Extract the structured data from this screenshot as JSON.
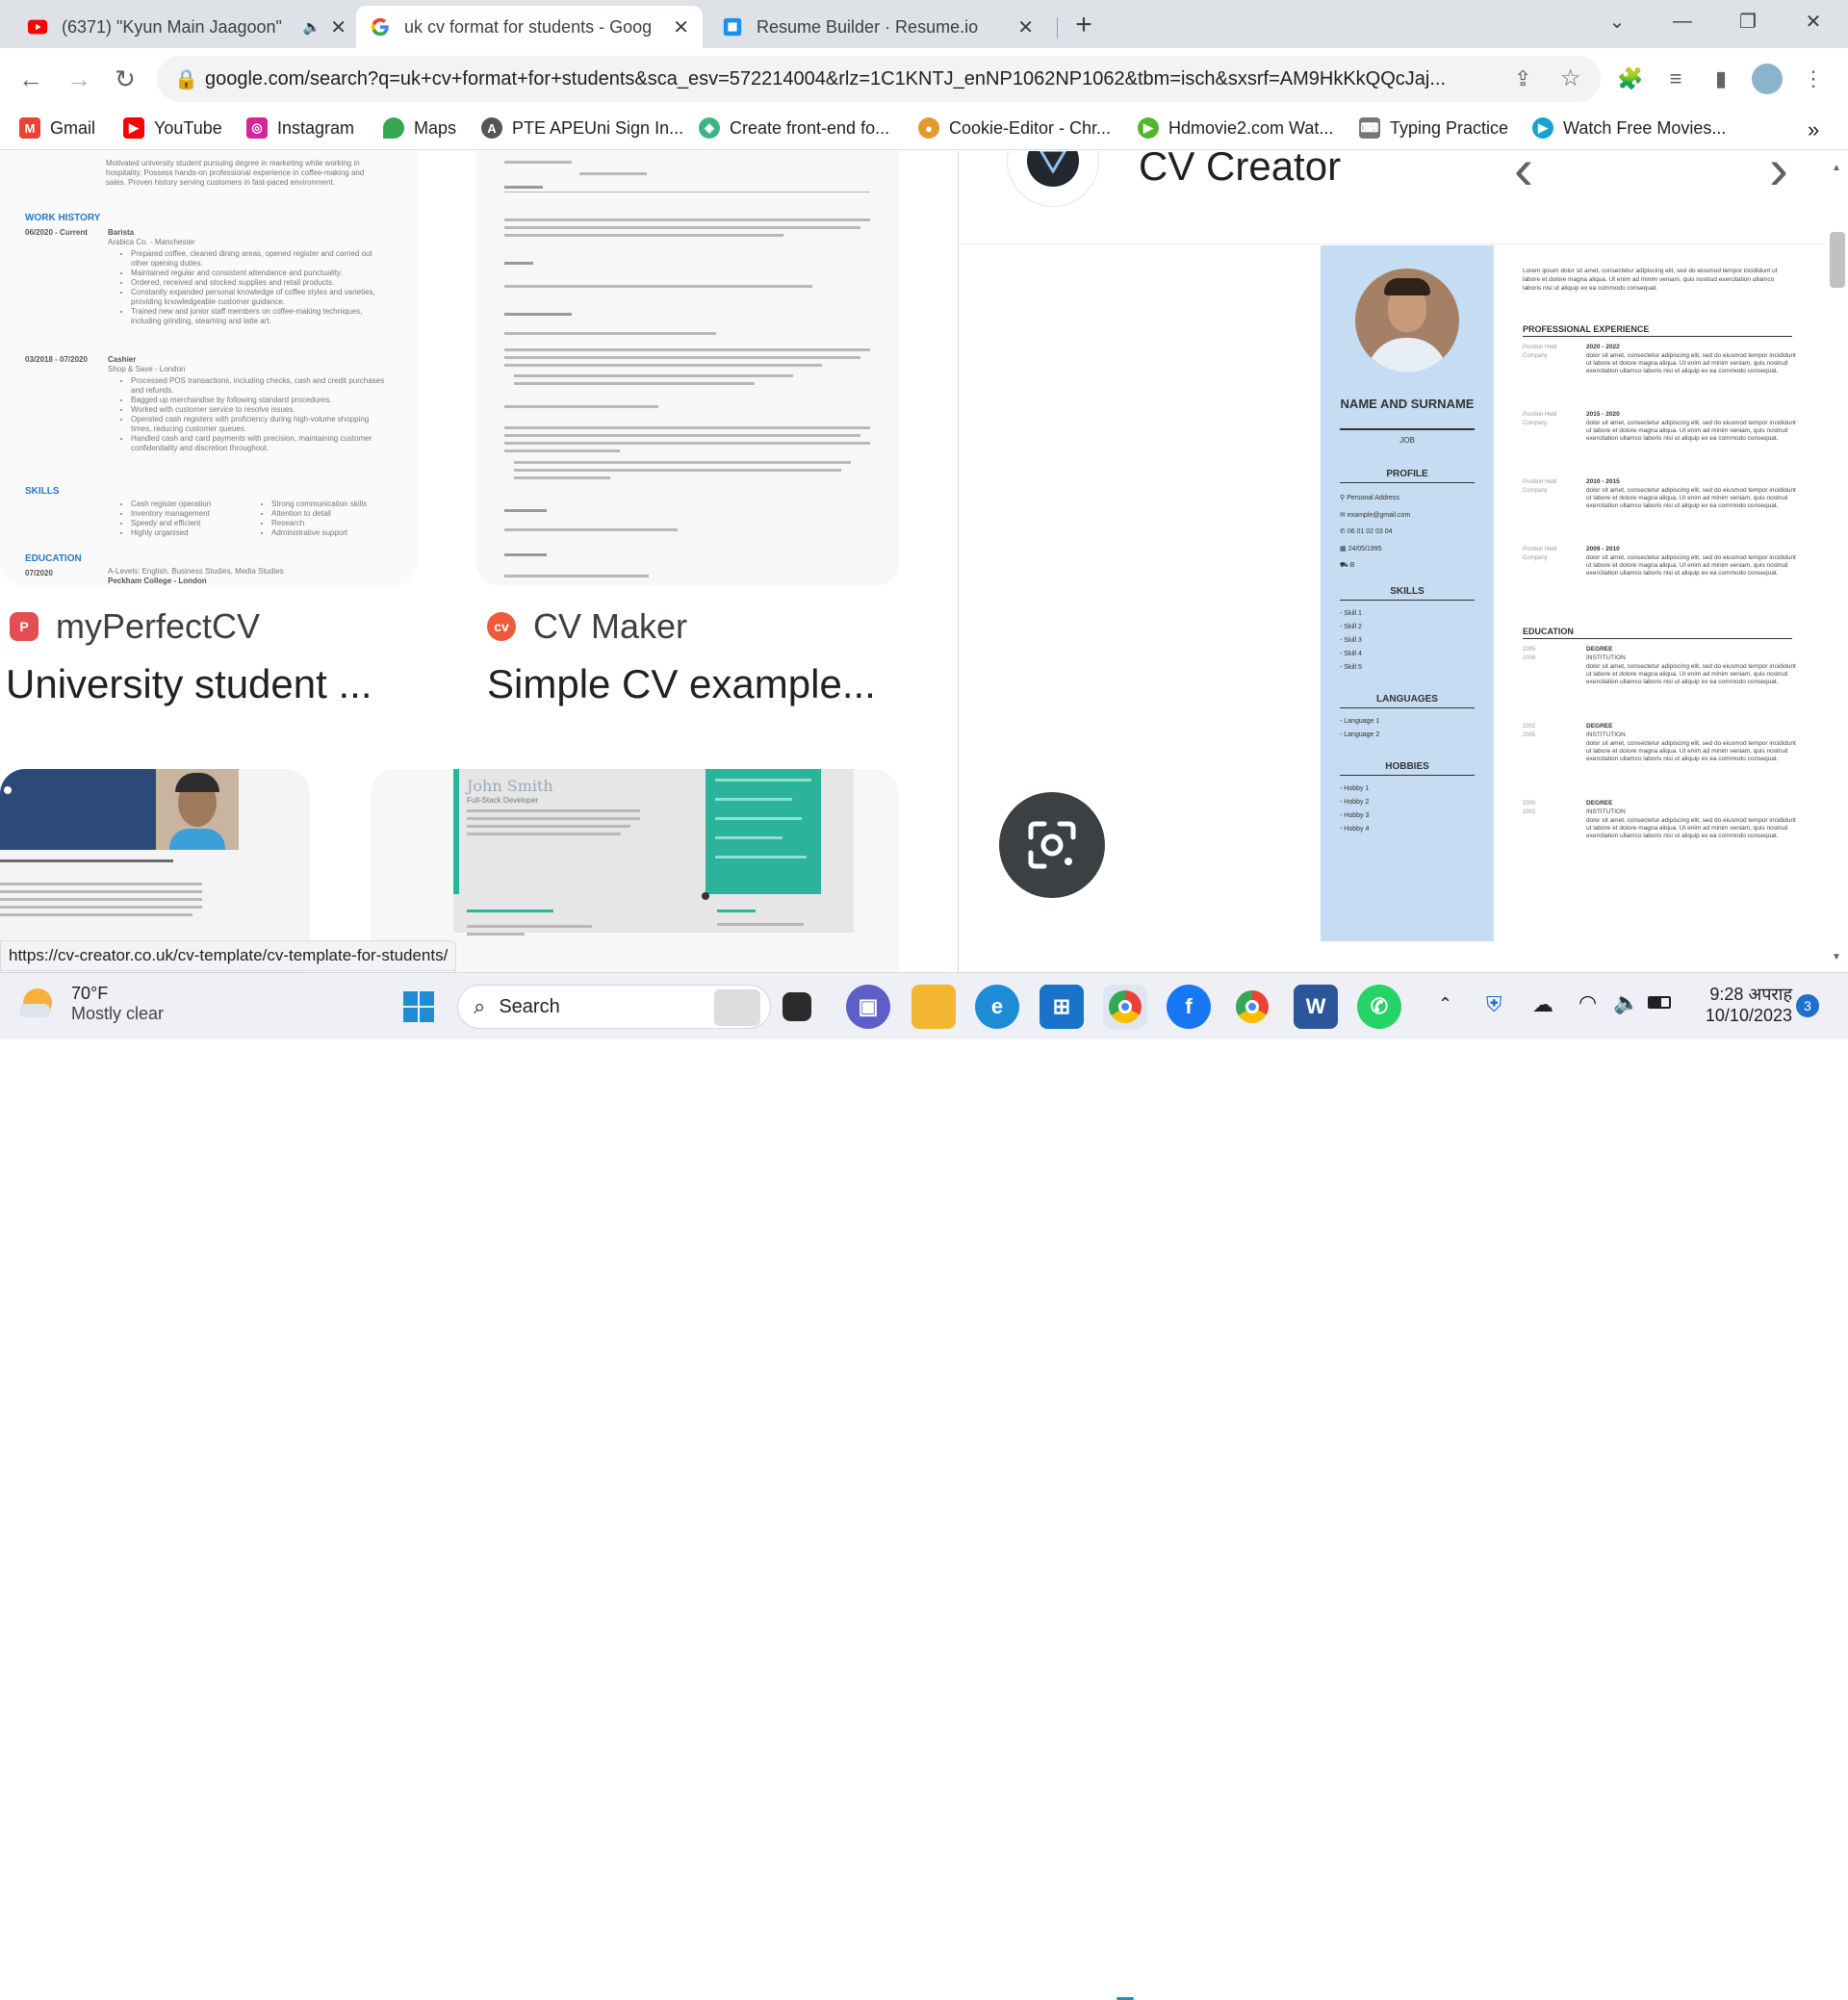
{
  "browser": {
    "tabs": [
      {
        "title": "(6371) \"Kyun Main Jaagoon\"",
        "favicon": "youtube-icon",
        "active": false
      },
      {
        "title": "uk cv format for students - Goog",
        "favicon": "google-icon",
        "active": true
      },
      {
        "title": "Resume Builder · Resume.io",
        "favicon": "resume-io-icon",
        "active": false
      }
    ],
    "new_tab": "+",
    "url": "google.com/search?q=uk+cv+format+for+students&sca_esv=572214004&rlz=1C1KNTJ_enNP1062NP1062&tbm=isch&sxsrf=AM9HkKkQQcJaj...",
    "bookmarks": [
      {
        "label": "Gmail",
        "icon": "gmail-icon",
        "color": "#ea4335"
      },
      {
        "label": "YouTube",
        "icon": "youtube-icon",
        "color": "#ff0000"
      },
      {
        "label": "Instagram",
        "icon": "instagram-icon",
        "color": "#d6249f"
      },
      {
        "label": "Maps",
        "icon": "maps-icon",
        "color": "#34a853"
      },
      {
        "label": "PTE APEUni Sign In...",
        "icon": "apeuni-icon",
        "color": "#555555"
      },
      {
        "label": "Create front-end fo...",
        "icon": "frontend-icon",
        "color": "#3bb585"
      },
      {
        "label": "Cookie-Editor - Chr...",
        "icon": "cookie-icon",
        "color": "#e39a2d"
      },
      {
        "label": "Hdmovie2.com Wat...",
        "icon": "hdmovie-icon",
        "color": "#52b52b"
      },
      {
        "label": "Typing Practice",
        "icon": "typing-icon",
        "color": "#777777"
      },
      {
        "label": "Watch Free Movies...",
        "icon": "play-icon",
        "color": "#17a2d6"
      }
    ],
    "bookmarks_more": "»"
  },
  "results": {
    "cards": [
      {
        "source": "myPerfectCV",
        "title": "University student ...",
        "icon_color": "#e44d51"
      },
      {
        "source": "CV Maker",
        "title": "Simple CV example...",
        "icon_color": "#ef5a3c"
      }
    ],
    "left_cv": {
      "sections": [
        "WORK HISTORY",
        "SKILLS",
        "EDUCATION"
      ],
      "dates": [
        "06/2020 - Current",
        "03/2018 - 07/2020",
        "07/2020"
      ],
      "roles": [
        "Barista",
        "Arabica Co. - Manchester",
        "Cashier",
        "Shop & Save - London"
      ],
      "bullets": [
        "Prepared coffee, cleaned dining areas, opened register and carried out other opening duties.",
        "Maintained regular and consistent attendance and punctuality.",
        "Ordered, received and stocked supplies and retail products.",
        "Constantly expanded personal knowledge of coffee styles and varieties, providing knowledgeable customer guidance.",
        "Trained new and junior staff members on coffee-making techniques, including grinding, steaming and latte art.",
        "Processed POS transactions, including checks, cash and credit purchases and refunds.",
        "Bagged up merchandise by following standard procedures.",
        "Worked with customer service to resolve issues.",
        "Operated cash registers with proficiency during high-volume shopping times, reducing customer queues.",
        "Handled cash and card payments with precision, maintaining customer confidentiality and discretion throughout."
      ],
      "intro": "Motivated university student pursuing degree in marketing while working in hospitality. Possess hands-on professional experience in coffee-making and sales. Proven history serving customers in fast-paced environment.",
      "skills": [
        "Cash register operation",
        "Inventory management",
        "Speedy and efficient",
        "Highly organised",
        "Strong communication skills",
        "Attention to detail",
        "Research",
        "Administrative support"
      ],
      "education": "A-Levels: English, Business Studies, Media Studies",
      "school": "Peckham College - London"
    },
    "bottom_cv": {
      "name": "John Smith",
      "role": "Full-Stack Developer"
    }
  },
  "preview": {
    "site_name": "CV Creator",
    "prev": "‹",
    "next": "›",
    "resume": {
      "name": "NAME AND SURNAME",
      "job": "JOB",
      "profile_heading": "PROFILE",
      "contacts": [
        {
          "icon": "location-icon",
          "text": "Personal Address"
        },
        {
          "icon": "mail-icon",
          "text": "example@gmail.com"
        },
        {
          "icon": "phone-icon",
          "text": "06 01 02 03 04"
        },
        {
          "icon": "calendar-icon",
          "text": "24/05/1995"
        },
        {
          "icon": "car-icon",
          "text": "B"
        }
      ],
      "skills_heading": "SKILLS",
      "skills": [
        "- Skill 1",
        "- Skill 2",
        "- Skill 3",
        "- Skill 4",
        "- Skill 5"
      ],
      "languages_heading": "LANGUAGES",
      "languages": [
        "- Language 1",
        "- Language 2"
      ],
      "hobbies_heading": "HOBBIES",
      "hobbies": [
        "- Hobby 1",
        "- Hobby 2",
        "- Hobby 3",
        "- Hobby 4"
      ],
      "intro": "Lorem ipsum dolor sit amet, consectetur adipiscing elit, sed do eiusmod tempor incididunt ut labore et dolore magna aliqua. Ut enim ad minim veniam, quis nostrud exercitation ullamco laboris nisi ut aliquip ex ea commodo consequat.",
      "experience_heading": "PROFESSIONAL EXPERIENCE",
      "experience": [
        {
          "left": "Position Held\nCompany",
          "date": "2020 - 2022"
        },
        {
          "left": "Position Held\nCompany",
          "date": "2015 - 2020"
        },
        {
          "left": "Position Held\nCompany",
          "date": "2010 - 2015"
        },
        {
          "left": "Position Held\nCompany",
          "date": "2009 - 2010"
        }
      ],
      "experience_text": "dolor sit amet, consectetur adipiscing elit, sed do eiusmod tempor incididunt ut labore et dolore magna aliqua. Ut enim ad minim veniam, quis nostrud exercitation ullamco laboris nisi ut aliquip ex ea commodo consequat.",
      "education_heading": "EDUCATION",
      "education": [
        {
          "years": "2005\n2008",
          "degree": "DEGREE",
          "inst": "INSTITUTION"
        },
        {
          "years": "2002\n2005",
          "degree": "DEGREE",
          "inst": "INSTITUTION"
        },
        {
          "years": "2000\n2002",
          "degree": "DEGREE",
          "inst": "INSTITUTION"
        }
      ]
    }
  },
  "status_url": "https://cv-creator.co.uk/cv-template/cv-template-for-students/",
  "taskbar": {
    "weather_temp": "70°F",
    "weather_desc": "Mostly clear",
    "search_placeholder": "Search",
    "time": "9:28 अपराह",
    "date": "10/10/2023",
    "notification_count": "3"
  }
}
